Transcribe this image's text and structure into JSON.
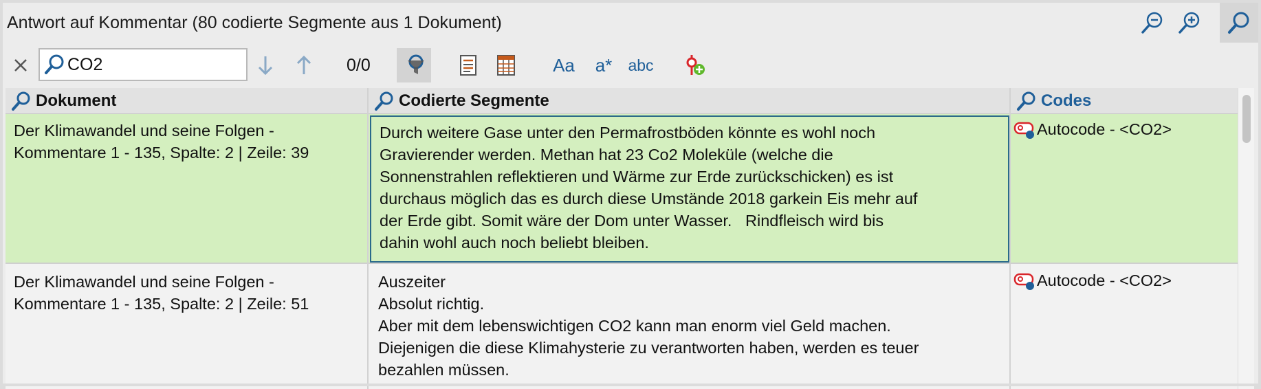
{
  "window": {
    "title": "Antwort auf Kommentar (80 codierte Segmente aus 1 Dokument)"
  },
  "titlebar_icons": [
    "zoom-out-icon",
    "zoom-in-icon",
    "search-toggle-icon"
  ],
  "toolbar": {
    "search_value": "CO2",
    "counter": "0/0",
    "case_label": "Aa",
    "regex_label": "a*",
    "whole_word_label": "abc"
  },
  "table": {
    "columns": [
      {
        "label": "Dokument"
      },
      {
        "label": "Codierte Segmente"
      },
      {
        "label": "Codes"
      }
    ],
    "rows": [
      {
        "doc_line1": "Der Klimawandel und seine Folgen -",
        "doc_line2": "Kommentare 1 - 135, Spalte: 2 | Zeile: 39",
        "seg_lines": [
          "Durch weitere Gase unter den Permafrostböden könnte es wohl noch",
          "Gravierender werden. Methan hat 23 Co2 Moleküle (welche die",
          "Sonnenstrahlen reflektieren und Wärme zur Erde zurückschicken) es ist",
          "durchaus möglich das es durch diese Umstände 2018 garkein Eis mehr auf",
          "der Erde gibt. Somit wäre der Dom unter Wasser.   Rindfleisch wird bis",
          "dahin wohl auch noch beliebt bleiben."
        ],
        "code": "Autocode - <CO2>"
      },
      {
        "doc_line1": "Der Klimawandel und seine Folgen -",
        "doc_line2": "Kommentare 1 - 135, Spalte: 2 | Zeile: 51",
        "seg_lines": [
          "Auszeiter",
          "Absolut richtig.",
          "Aber mit dem lebenswichtigen CO2 kann man enorm viel Geld machen.",
          "Diejenigen die diese Klimahysterie zu verantworten haben, werden es teuer",
          "bezahlen müssen."
        ],
        "code": "Autocode - <CO2>"
      }
    ]
  },
  "colors": {
    "accent_blue": "#1f5f99",
    "selected_row": "#d4efbf",
    "code_red": "#d9262b"
  }
}
